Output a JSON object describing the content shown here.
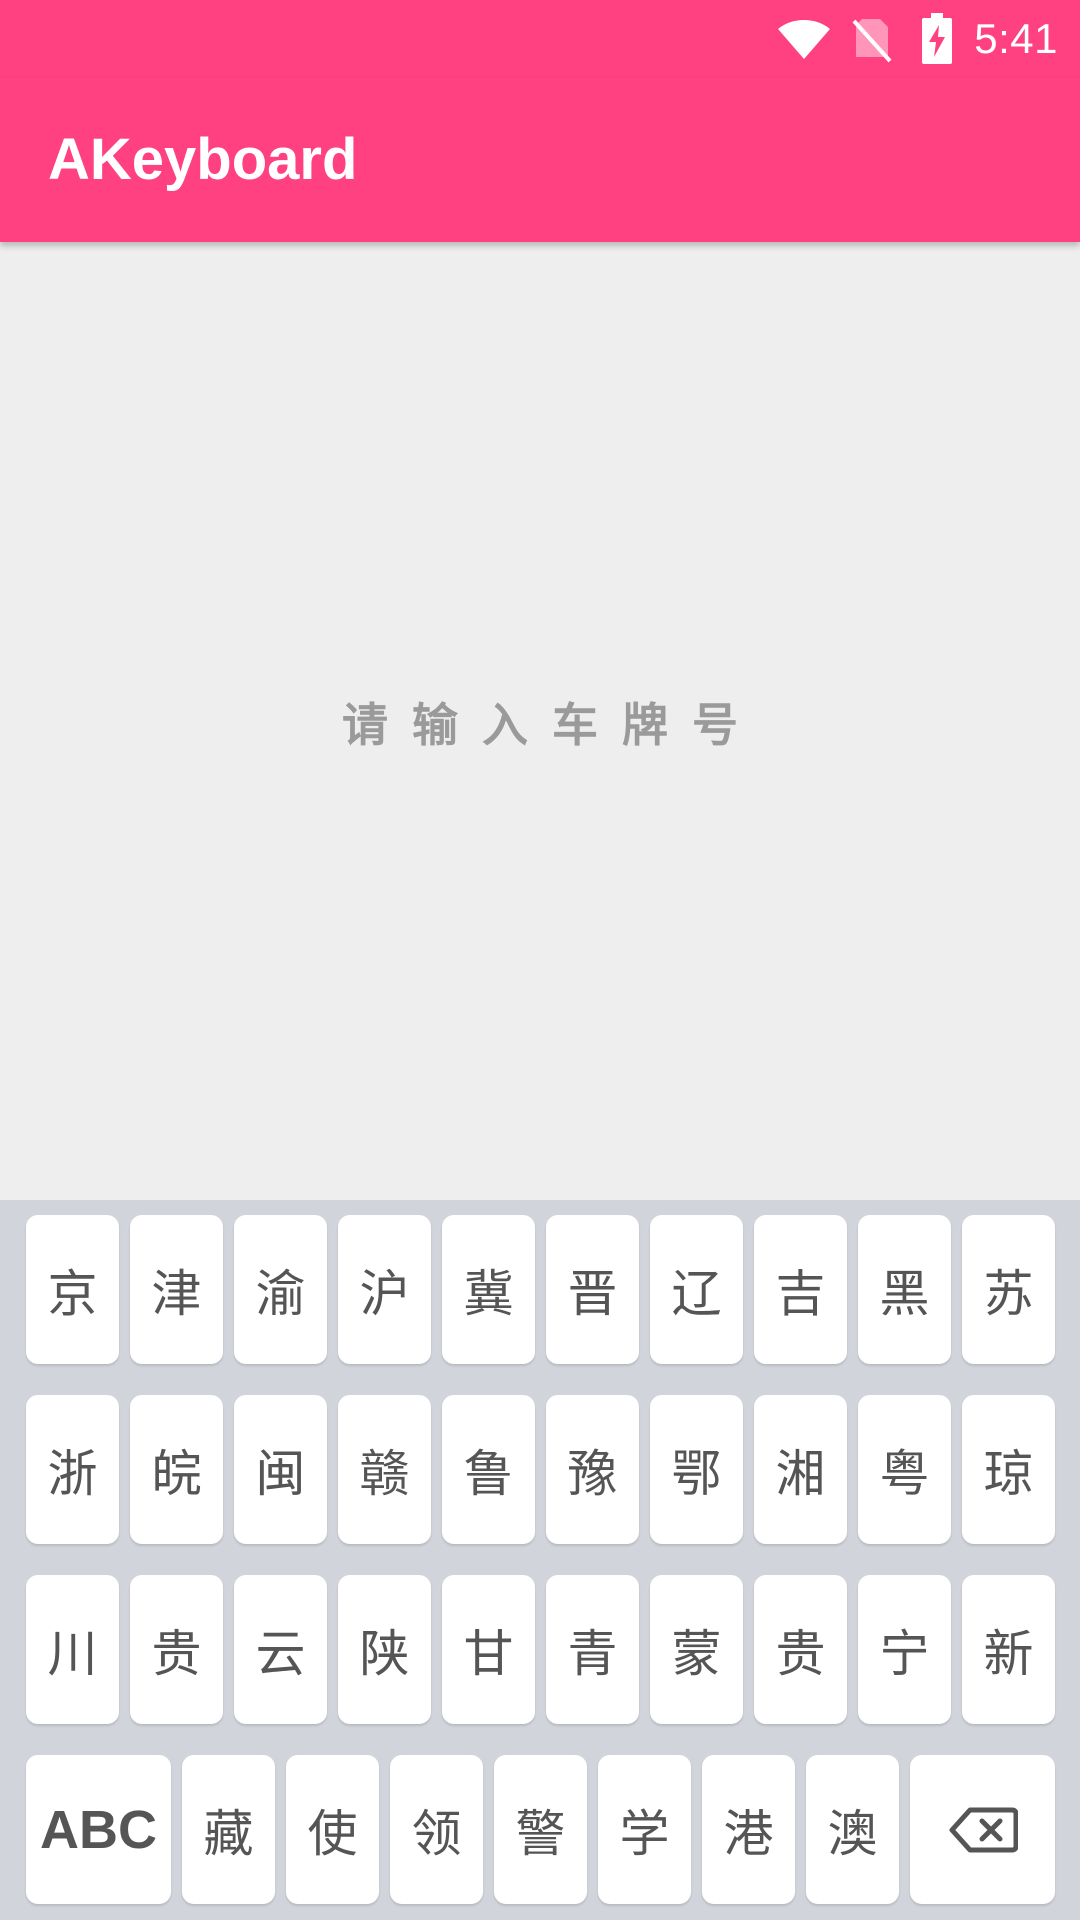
{
  "status_bar": {
    "time": "5:41",
    "icons": [
      "wifi-icon",
      "no-sim-icon",
      "battery-charging-icon"
    ]
  },
  "app_bar": {
    "title": "AKeyboard"
  },
  "content": {
    "plate_prompt": "请输入车牌号"
  },
  "keyboard": {
    "row1": [
      "京",
      "津",
      "渝",
      "沪",
      "冀",
      "晋",
      "辽",
      "吉",
      "黑",
      "苏"
    ],
    "row2": [
      "浙",
      "皖",
      "闽",
      "赣",
      "鲁",
      "豫",
      "鄂",
      "湘",
      "粤",
      "琼"
    ],
    "row3": [
      "川",
      "贵",
      "云",
      "陕",
      "甘",
      "青",
      "蒙",
      "贵",
      "宁",
      "新"
    ],
    "row4": {
      "abc_label": "ABC",
      "keys": [
        "藏",
        "使",
        "领",
        "警",
        "学",
        "港",
        "澳"
      ],
      "delete_icon": "backspace-icon"
    }
  },
  "colors": {
    "accent": "#ff4081",
    "background": "#eeeeee",
    "keyboard_background": "#d1d5db",
    "key_background": "#ffffff",
    "key_text": "#555555",
    "prompt_text": "#9a9a9a"
  }
}
